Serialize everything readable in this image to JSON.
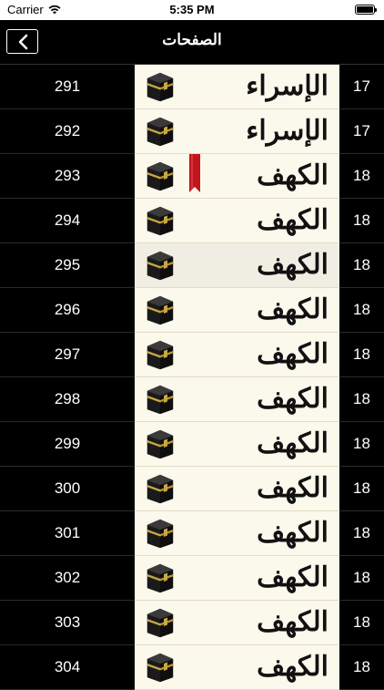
{
  "status_bar": {
    "carrier": "Carrier",
    "time": "5:35 PM"
  },
  "nav": {
    "title": "الصفحات"
  },
  "rows": [
    {
      "page": "291",
      "surah": "الإسراء",
      "juz": "17",
      "bookmarked": false,
      "highlight": false
    },
    {
      "page": "292",
      "surah": "الإسراء",
      "juz": "17",
      "bookmarked": false,
      "highlight": false
    },
    {
      "page": "293",
      "surah": "الكهف",
      "juz": "18",
      "bookmarked": true,
      "highlight": false
    },
    {
      "page": "294",
      "surah": "الكهف",
      "juz": "18",
      "bookmarked": false,
      "highlight": false
    },
    {
      "page": "295",
      "surah": "الكهف",
      "juz": "18",
      "bookmarked": false,
      "highlight": true
    },
    {
      "page": "296",
      "surah": "الكهف",
      "juz": "18",
      "bookmarked": false,
      "highlight": false
    },
    {
      "page": "297",
      "surah": "الكهف",
      "juz": "18",
      "bookmarked": false,
      "highlight": false
    },
    {
      "page": "298",
      "surah": "الكهف",
      "juz": "18",
      "bookmarked": false,
      "highlight": false
    },
    {
      "page": "299",
      "surah": "الكهف",
      "juz": "18",
      "bookmarked": false,
      "highlight": false
    },
    {
      "page": "300",
      "surah": "الكهف",
      "juz": "18",
      "bookmarked": false,
      "highlight": false
    },
    {
      "page": "301",
      "surah": "الكهف",
      "juz": "18",
      "bookmarked": false,
      "highlight": false
    },
    {
      "page": "302",
      "surah": "الكهف",
      "juz": "18",
      "bookmarked": false,
      "highlight": false
    },
    {
      "page": "303",
      "surah": "الكهف",
      "juz": "18",
      "bookmarked": false,
      "highlight": false
    },
    {
      "page": "304",
      "surah": "الكهف",
      "juz": "18",
      "bookmarked": false,
      "highlight": false
    }
  ],
  "colors": {
    "bar_bg": "#000000",
    "cell_bg": "#fbf8ec",
    "bookmark": "#c0161c"
  }
}
